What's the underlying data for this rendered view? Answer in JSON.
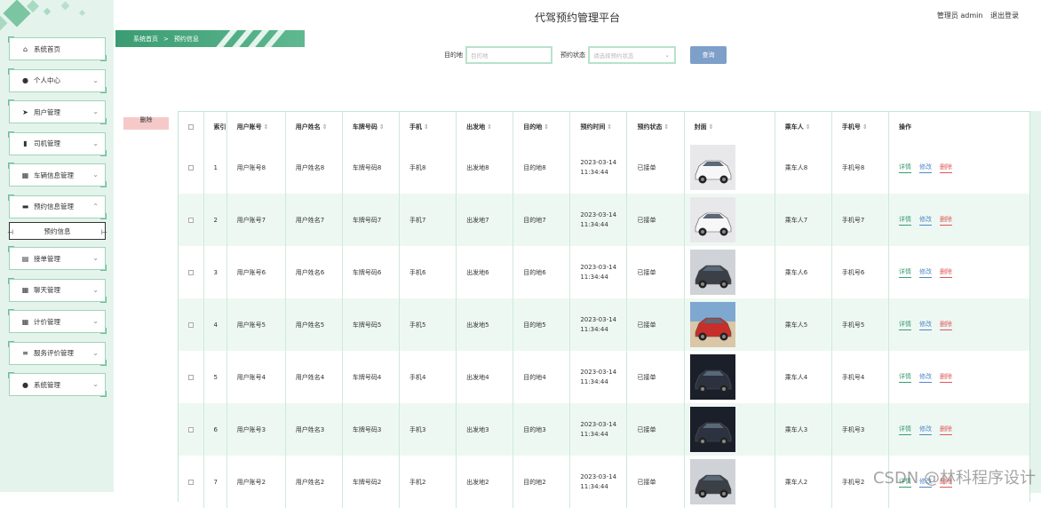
{
  "header": {
    "title": "代驾预约管理平台",
    "user_label": "管理员 admin",
    "logout_label": "退出登录"
  },
  "breadcrumb": {
    "home": "系统首页",
    "separator": ">",
    "current": "预约信息"
  },
  "sidebar": {
    "items": [
      {
        "label": "系统首页",
        "icon": "home-icon",
        "has_chevron": false
      },
      {
        "label": "个人中心",
        "icon": "person-icon",
        "has_chevron": true
      },
      {
        "label": "用户管理",
        "icon": "send-icon",
        "has_chevron": true
      },
      {
        "label": "司机管理",
        "icon": "chart-icon",
        "has_chevron": true
      },
      {
        "label": "车辆信息管理",
        "icon": "grid-icon",
        "has_chevron": true
      },
      {
        "label": "预约信息管理",
        "icon": "briefcase-icon",
        "has_chevron": true,
        "expanded": true
      }
    ],
    "submenu_label": "预约信息",
    "items_after": [
      {
        "label": "接单管理",
        "icon": "clipboard-icon"
      },
      {
        "label": "聊天管理",
        "icon": "grid-icon"
      },
      {
        "label": "计价管理",
        "icon": "grid-icon"
      },
      {
        "label": "服务评价管理",
        "icon": "list-icon"
      },
      {
        "label": "系统管理",
        "icon": "person-icon"
      }
    ]
  },
  "search": {
    "destination_label": "目的地",
    "destination_placeholder": "目的地",
    "status_label": "预约状态",
    "status_placeholder": "请选择预约状态",
    "query_button": "查询"
  },
  "delete_button": "删除",
  "table": {
    "columns": [
      "索引",
      "用户账号",
      "用户姓名",
      "车牌号码",
      "手机",
      "出发地",
      "目的地",
      "预约时间",
      "预约状态",
      "封面",
      "乘车人",
      "手机号",
      "操作"
    ],
    "rows": [
      {
        "idx": "1",
        "account": "用户账号8",
        "name": "用户姓名8",
        "plate": "车牌号码8",
        "phone": "手机8",
        "from": "出发地8",
        "to": "目的地8",
        "date": "2023-03-14",
        "time": "11:34:44",
        "status": "已接单",
        "cover": "white-suv",
        "passenger": "乘车人8",
        "mobile": "手机号8"
      },
      {
        "idx": "2",
        "account": "用户账号7",
        "name": "用户姓名7",
        "plate": "车牌号码7",
        "phone": "手机7",
        "from": "出发地7",
        "to": "目的地7",
        "date": "2023-03-14",
        "time": "11:34:44",
        "status": "已接单",
        "cover": "white-suv",
        "passenger": "乘车人7",
        "mobile": "手机号7"
      },
      {
        "idx": "3",
        "account": "用户账号6",
        "name": "用户姓名6",
        "plate": "车牌号码6",
        "phone": "手机6",
        "from": "出发地6",
        "to": "目的地6",
        "date": "2023-03-14",
        "time": "11:34:44",
        "status": "已接单",
        "cover": "dark-suv",
        "passenger": "乘车人6",
        "mobile": "手机号6"
      },
      {
        "idx": "4",
        "account": "用户账号5",
        "name": "用户姓名5",
        "plate": "车牌号码5",
        "phone": "手机5",
        "from": "出发地5",
        "to": "目的地5",
        "date": "2023-03-14",
        "time": "11:34:44",
        "status": "已接单",
        "cover": "red-car",
        "passenger": "乘车人5",
        "mobile": "手机号5"
      },
      {
        "idx": "5",
        "account": "用户账号4",
        "name": "用户姓名4",
        "plate": "车牌号码4",
        "phone": "手机4",
        "from": "出发地4",
        "to": "目的地4",
        "date": "2023-03-14",
        "time": "11:34:44",
        "status": "已接单",
        "cover": "dark-sedan",
        "passenger": "乘车人4",
        "mobile": "手机号4"
      },
      {
        "idx": "6",
        "account": "用户账号3",
        "name": "用户姓名3",
        "plate": "车牌号码3",
        "phone": "手机3",
        "from": "出发地3",
        "to": "目的地3",
        "date": "2023-03-14",
        "time": "11:34:44",
        "status": "已接单",
        "cover": "dark-sedan",
        "passenger": "乘车人3",
        "mobile": "手机号3"
      },
      {
        "idx": "7",
        "account": "用户账号2",
        "name": "用户姓名2",
        "plate": "车牌号码2",
        "phone": "手机2",
        "from": "出发地2",
        "to": "目的地2",
        "date": "2023-03-14",
        "time": "11:34:44",
        "status": "已接单",
        "cover": "dark-suv",
        "passenger": "乘车人2",
        "mobile": "手机号2"
      }
    ],
    "ops": {
      "view": "详情",
      "edit": "修改",
      "delete": "删除"
    }
  },
  "watermark": "CSDN @林科程序设计",
  "colors": {
    "accent": "#3a9c72",
    "sidebar_bg": "#e4f4ec",
    "stripe_row": "#eef8f3",
    "query_btn": "#7e9fc8",
    "delete_btn": "#f6c9c9"
  }
}
